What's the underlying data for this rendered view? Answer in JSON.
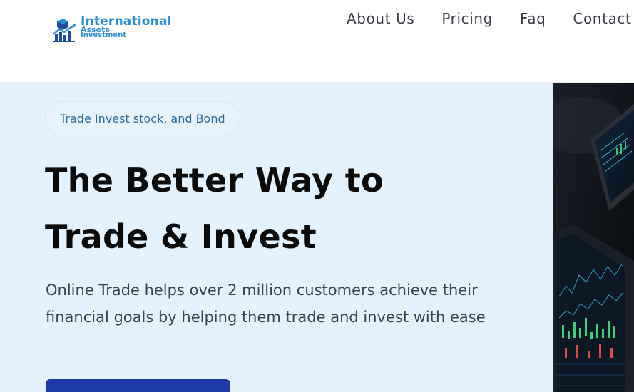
{
  "brand": {
    "line1": "International",
    "line2": "Assets",
    "line3": "Investment"
  },
  "nav": {
    "items": [
      "About Us",
      "Pricing",
      "Faq",
      "Contact"
    ]
  },
  "hero": {
    "tagline": "Trade Invest stock, and Bond",
    "headline_line1": "The Better Way to",
    "headline_line2": "Trade & Invest",
    "description": "Online Trade helps over 2 million customers achieve their financial goals by helping them trade and invest with ease"
  },
  "colors": {
    "hero_bg": "#e3f2fc",
    "cta_bg": "#1e3aa8",
    "brand_blue": "#2b8fd6",
    "nav_text": "#3b3f47"
  }
}
